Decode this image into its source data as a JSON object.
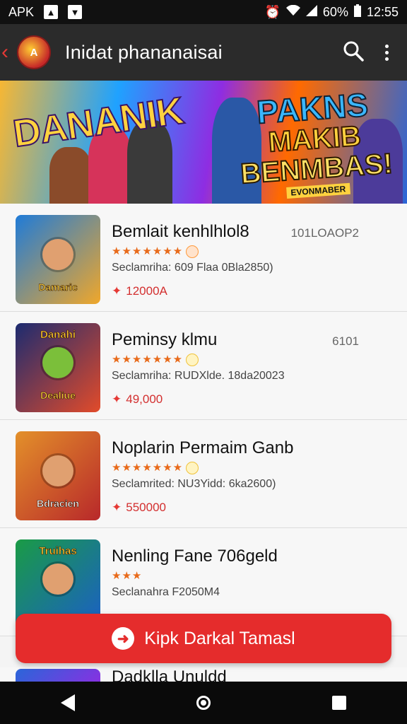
{
  "status_bar": {
    "left_label": "APK",
    "battery": "60%",
    "time": "12:55"
  },
  "app_bar": {
    "logo_text": "A",
    "title": "Inidat phananaisai",
    "search_icon": "search-icon",
    "more_icon": "more-vert-icon"
  },
  "banner": {
    "left_title": "DANANIK",
    "right_words": [
      "PAKNS",
      "MAKIB",
      "BENMBAS!"
    ],
    "tag": "EVONMABER"
  },
  "items": [
    {
      "title": "Bemlait kenhlhlol8",
      "meta": "101LOAOP2",
      "stars": "★★★★★★★",
      "subtitle": "Seclamriha: 609 Flaa 0Bla2850)",
      "price": "12000A",
      "thumb_top": "",
      "thumb_label": "Damaric",
      "colors": [
        "#1f7bd8",
        "#f0a72a"
      ]
    },
    {
      "title": "Peminsy klmu",
      "meta": "6101",
      "stars": "★★★★★★★",
      "subtitle": "Seclamriha: RUDXlde. 18da20023",
      "price": "49,000",
      "thumb_top": "Danahi",
      "thumb_label": "Dealiue",
      "colors": [
        "#1c2b70",
        "#e24b2a"
      ]
    },
    {
      "title": "Noplarin Permaim Ganb",
      "meta": "",
      "stars": "★★★★★★★",
      "subtitle": "Seclamrited: NU3Yidd: 6ka2600)",
      "price": "550000",
      "thumb_top": "",
      "thumb_label": "Bdracien",
      "colors": [
        "#e3902a",
        "#b8282a"
      ]
    },
    {
      "title": "Nenling Fane 706geld",
      "meta": "",
      "stars": "★★★",
      "subtitle": "Seclanahra F2050M4",
      "price": "",
      "thumb_top": "Truihas",
      "thumb_label": "",
      "colors": [
        "#1a9b45",
        "#1b5fc7"
      ]
    }
  ],
  "download_button": {
    "label": "Kipk Darkal Tamasl"
  },
  "peek_item": {
    "title": "Dadklla Unuldd"
  }
}
